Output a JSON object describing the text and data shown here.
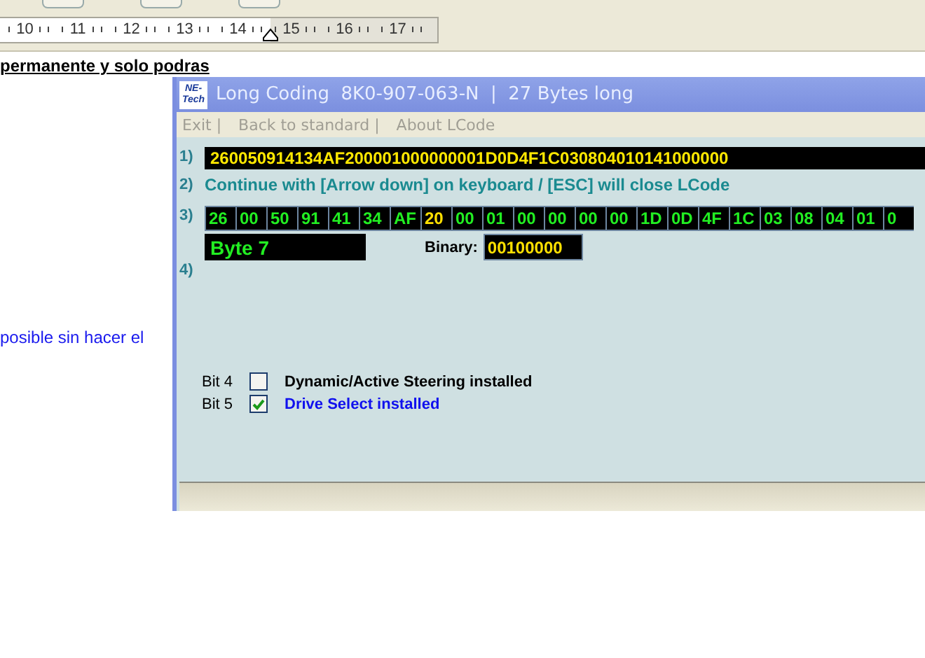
{
  "ruler": {
    "numbers": [
      "10",
      "11",
      "12",
      "13",
      "14",
      "15",
      "16",
      "17"
    ]
  },
  "document": {
    "lines": [
      {
        "kind": "underlined",
        "text": "permanente y solo podras"
      },
      {
        "kind": "link",
        "text": "posible sin hacer el"
      }
    ]
  },
  "window": {
    "logo": "NE-Tech",
    "title": "Long Coding  8K0-907-063-N  |  27 Bytes long",
    "menu": [
      "Exit |",
      "Back to standard |",
      "About LCode"
    ],
    "rows": [
      {
        "number": "1)",
        "coding": "260050914134AF200001000000001D0D4F1C030804010141000000"
      },
      {
        "number": "2)",
        "hint": "Continue with [Arrow down] on keyboard / [ESC] will close LCode"
      },
      {
        "number": "3)",
        "bytes": [
          {
            "value": "26",
            "selected": false
          },
          {
            "value": "00",
            "selected": false
          },
          {
            "value": "50",
            "selected": false
          },
          {
            "value": "91",
            "selected": false
          },
          {
            "value": "41",
            "selected": false
          },
          {
            "value": "34",
            "selected": false
          },
          {
            "value": "AF",
            "selected": false
          },
          {
            "value": "20",
            "selected": true
          },
          {
            "value": "00",
            "selected": false
          },
          {
            "value": "01",
            "selected": false
          },
          {
            "value": "00",
            "selected": false
          },
          {
            "value": "00",
            "selected": false
          },
          {
            "value": "00",
            "selected": false
          },
          {
            "value": "00",
            "selected": false
          },
          {
            "value": "1D",
            "selected": false
          },
          {
            "value": "0D",
            "selected": false
          },
          {
            "value": "4F",
            "selected": false
          },
          {
            "value": "1C",
            "selected": false
          },
          {
            "value": "03",
            "selected": false
          },
          {
            "value": "08",
            "selected": false
          },
          {
            "value": "04",
            "selected": false
          },
          {
            "value": "01",
            "selected": false
          },
          {
            "value": "0",
            "selected": false
          }
        ],
        "byte_label": "Byte 7",
        "binary_label": "Binary:",
        "binary": "00100000"
      },
      {
        "number": "4)"
      }
    ],
    "bits": [
      {
        "bit": "Bit 4",
        "label": "Dynamic/Active Steering installed",
        "checked": false
      },
      {
        "bit": "Bit 5",
        "label": "Drive Select installed",
        "checked": true
      }
    ]
  }
}
